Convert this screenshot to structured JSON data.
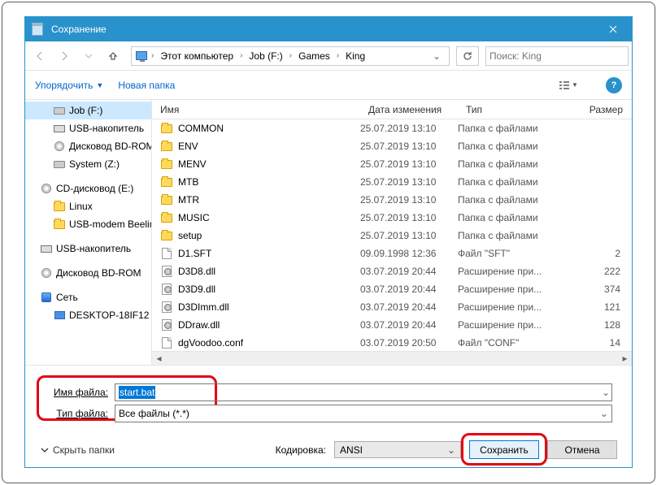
{
  "title": "Сохранение",
  "breadcrumb": [
    "Этот компьютер",
    "Job (F:)",
    "Games",
    "King"
  ],
  "search_placeholder": "Поиск: King",
  "cmd_organize": "Упорядочить",
  "cmd_newfolder": "Новая папка",
  "tree": [
    {
      "label": "Job (F:)",
      "icon": "drive",
      "sel": true,
      "lvl": 2
    },
    {
      "label": "USB-накопитель",
      "icon": "usb",
      "lvl": 2
    },
    {
      "label": "Дисковод BD-ROM",
      "icon": "disc",
      "lvl": 2
    },
    {
      "label": "System (Z:)",
      "icon": "drive",
      "lvl": 2
    },
    {
      "spacer": true
    },
    {
      "label": "CD-дисковод (E:)",
      "icon": "disc",
      "lvl": 1
    },
    {
      "label": "Linux",
      "icon": "folder",
      "lvl": 2
    },
    {
      "label": "USB-modem Beeline",
      "icon": "folder",
      "lvl": 2
    },
    {
      "spacer": true
    },
    {
      "label": "USB-накопитель",
      "icon": "usb",
      "lvl": 1
    },
    {
      "spacer": true
    },
    {
      "label": "Дисковод BD-ROM",
      "icon": "disc",
      "lvl": 1
    },
    {
      "spacer": true
    },
    {
      "label": "Сеть",
      "icon": "net",
      "lvl": 1
    },
    {
      "label": "DESKTOP-18IF12",
      "icon": "pc",
      "lvl": 2
    }
  ],
  "columns": {
    "name": "Имя",
    "date": "Дата изменения",
    "type": "Тип",
    "size": "Размер"
  },
  "files": [
    {
      "name": "COMMON",
      "date": "25.07.2019 13:10",
      "type": "Папка с файлами",
      "size": "",
      "icon": "folder"
    },
    {
      "name": "ENV",
      "date": "25.07.2019 13:10",
      "type": "Папка с файлами",
      "size": "",
      "icon": "folder"
    },
    {
      "name": "MENV",
      "date": "25.07.2019 13:10",
      "type": "Папка с файлами",
      "size": "",
      "icon": "folder"
    },
    {
      "name": "MTB",
      "date": "25.07.2019 13:10",
      "type": "Папка с файлами",
      "size": "",
      "icon": "folder"
    },
    {
      "name": "MTR",
      "date": "25.07.2019 13:10",
      "type": "Папка с файлами",
      "size": "",
      "icon": "folder"
    },
    {
      "name": "MUSIC",
      "date": "25.07.2019 13:10",
      "type": "Папка с файлами",
      "size": "",
      "icon": "folder"
    },
    {
      "name": "setup",
      "date": "25.07.2019 13:10",
      "type": "Папка с файлами",
      "size": "",
      "icon": "folder"
    },
    {
      "name": "D1.SFT",
      "date": "09.09.1998 12:36",
      "type": "Файл \"SFT\"",
      "size": "2",
      "icon": "file"
    },
    {
      "name": "D3D8.dll",
      "date": "03.07.2019 20:44",
      "type": "Расширение при...",
      "size": "222",
      "icon": "dll"
    },
    {
      "name": "D3D9.dll",
      "date": "03.07.2019 20:44",
      "type": "Расширение при...",
      "size": "374",
      "icon": "dll"
    },
    {
      "name": "D3DImm.dll",
      "date": "03.07.2019 20:44",
      "type": "Расширение при...",
      "size": "121",
      "icon": "dll"
    },
    {
      "name": "DDraw.dll",
      "date": "03.07.2019 20:44",
      "type": "Расширение при...",
      "size": "128",
      "icon": "dll"
    },
    {
      "name": "dgVoodoo.conf",
      "date": "03.07.2019 20:50",
      "type": "Файл \"CONF\"",
      "size": "14",
      "icon": "file"
    }
  ],
  "filename_label": "Имя файла:",
  "filename_value": "start.bat",
  "filetype_label": "Тип файла:",
  "filetype_value": "Все файлы (*.*)",
  "hide_folders": "Скрыть папки",
  "encoding_label": "Кодировка:",
  "encoding_value": "ANSI",
  "save_btn": "Сохранить",
  "cancel_btn": "Отмена"
}
